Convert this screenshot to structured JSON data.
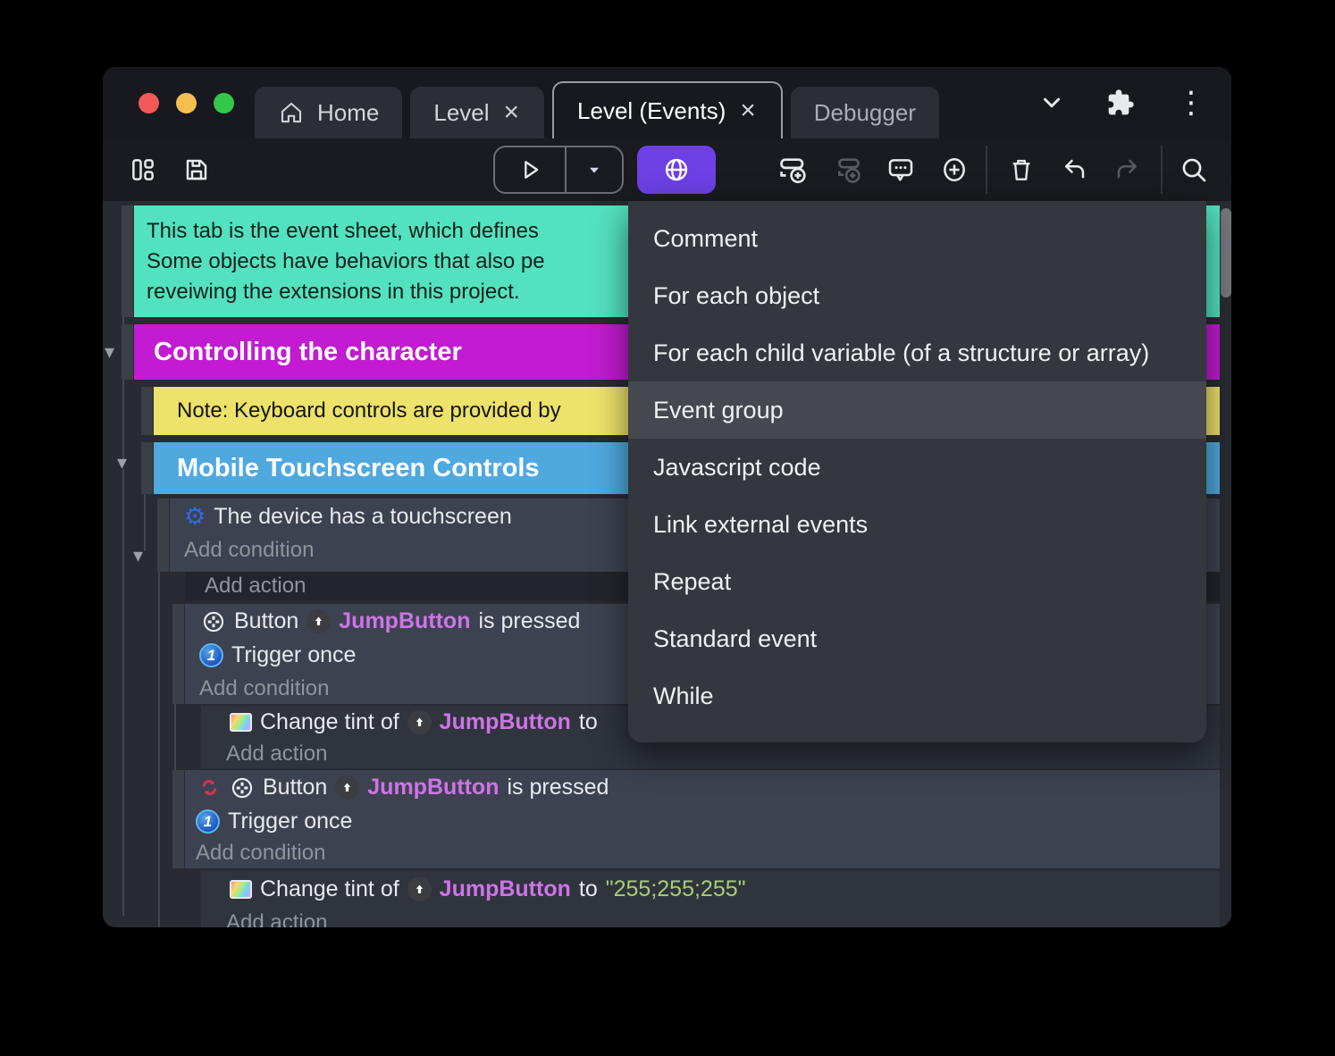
{
  "colors": {
    "comment_bg": "#53E2BF",
    "group_primary_bg": "#C21BD1",
    "note_bg": "#EDE26A",
    "group_secondary_bg": "#4FA9DF",
    "object_name_text": "#CE74E8",
    "string_value_text": "#A8CE74",
    "accent_button": "#6C40E4",
    "traffic_lights": [
      "#F25A58",
      "#F5BE4F",
      "#35C749"
    ]
  },
  "icons": {
    "close": "×",
    "collapse_arrow": "▾",
    "gear": "⚙",
    "trigger_once_badge": "1",
    "overflow_menu": "⋮"
  },
  "titlebar": {
    "tabs": [
      {
        "label": "Home"
      },
      {
        "label": "Level",
        "close": "×"
      },
      {
        "label": "Level (Events)",
        "close": "×"
      },
      {
        "label": "Debugger"
      }
    ]
  },
  "sheet": {
    "comment_lines": [
      "This tab is the event sheet, which defines",
      "Some objects have behaviors that also pe",
      "reveiwing the extensions in this project."
    ],
    "group_controlling": "Controlling the character",
    "note": "Note: Keyboard controls are provided by",
    "group_mobile": "Mobile Touchscreen Controls",
    "touchscreen_condition": "The device has a touchscreen",
    "add_condition": "Add condition",
    "add_action": "Add action",
    "button_condition": {
      "label": "Button",
      "object": "JumpButton",
      "suffix": "is pressed"
    },
    "trigger_once": "Trigger once",
    "tint_action": {
      "label": "Change tint of",
      "object": "JumpButton",
      "to": "to",
      "value": "\"255;255;255\""
    }
  },
  "context_menu": {
    "items": [
      "Comment",
      "For each object",
      "For each child variable (of a structure or array)",
      "Event group",
      "Javascript code",
      "Link external events",
      "Repeat",
      "Standard event",
      "While"
    ],
    "highlighted_item": "Event group"
  }
}
